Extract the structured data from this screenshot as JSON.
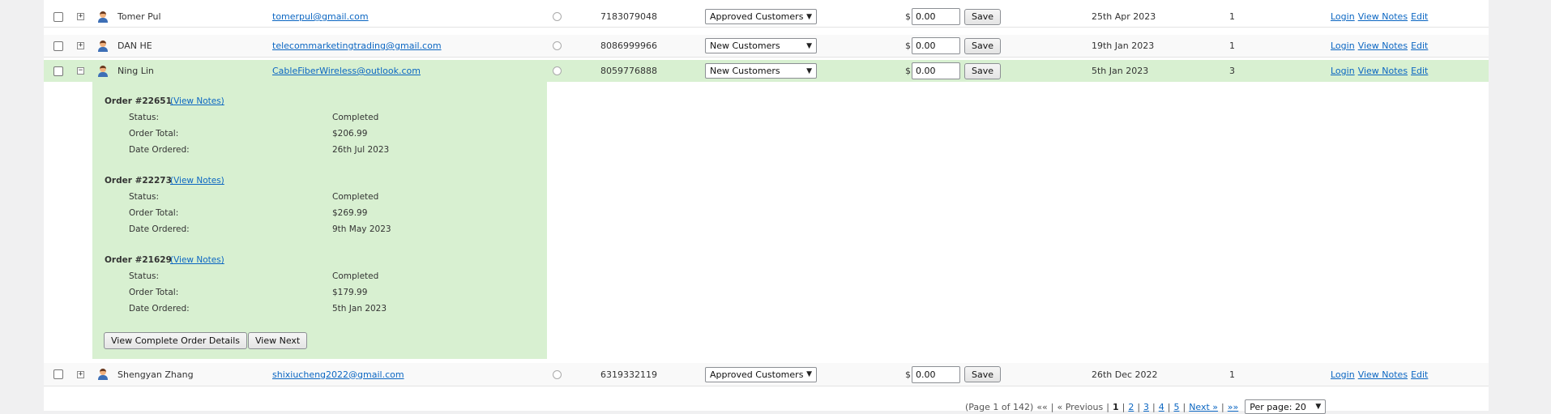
{
  "rows": [
    {
      "toggle": "+",
      "name": "Tomer Pul",
      "email": "tomerpul@gmail.com",
      "phone": "7183079048",
      "group": "Approved Customers",
      "currency": "$",
      "amount": "0.00",
      "save": "Save",
      "date": "25th Apr 2023",
      "orders": "1",
      "login": "Login",
      "view_notes": "View Notes",
      "edit": "Edit"
    },
    {
      "toggle": "+",
      "name": "DAN HE",
      "email": "telecommarketingtrading@gmail.com",
      "phone": "8086999966",
      "group": "New Customers",
      "currency": "$",
      "amount": "0.00",
      "save": "Save",
      "date": "19th Jan 2023",
      "orders": "1",
      "login": "Login",
      "view_notes": "View Notes",
      "edit": "Edit"
    },
    {
      "toggle": "−",
      "name": "Ning Lin",
      "email": "CableFiberWireless@outlook.com",
      "phone": "8059776888",
      "group": "New Customers",
      "currency": "$",
      "amount": "0.00",
      "save": "Save",
      "date": "5th Jan 2023",
      "orders": "3",
      "login": "Login",
      "view_notes": "View Notes",
      "edit": "Edit"
    },
    {
      "toggle": "+",
      "name": "Shengyan Zhang",
      "email": "shixiucheng2022@gmail.com",
      "phone": "6319332119",
      "group": "Approved Customers",
      "currency": "$",
      "amount": "0.00",
      "save": "Save",
      "date": "26th Dec 2022",
      "orders": "1",
      "login": "Login",
      "view_notes": "View Notes",
      "edit": "Edit"
    }
  ],
  "details": {
    "labels": {
      "status": "Status:",
      "total": "Order Total:",
      "date": "Date Ordered:"
    },
    "orders": [
      {
        "title": "Order #22651",
        "notes": "(View Notes)",
        "status": "Completed",
        "total": "$206.99",
        "date": "26th Jul 2023"
      },
      {
        "title": "Order #22273",
        "notes": "(View Notes)",
        "status": "Completed",
        "total": "$269.99",
        "date": "9th May 2023"
      },
      {
        "title": "Order #21629",
        "notes": "(View Notes)",
        "status": "Completed",
        "total": "$179.99",
        "date": "5th Jan 2023"
      }
    ],
    "btn_complete": "View Complete Order Details",
    "btn_next": "View Next"
  },
  "pager": {
    "info": "(Page 1 of 142)",
    "first": "««",
    "sep": "|",
    "prev": "« Previous",
    "pages": [
      "1",
      "2",
      "3",
      "4",
      "5"
    ],
    "next": "Next »",
    "last": "»»",
    "per_page": "Per page: 20"
  }
}
